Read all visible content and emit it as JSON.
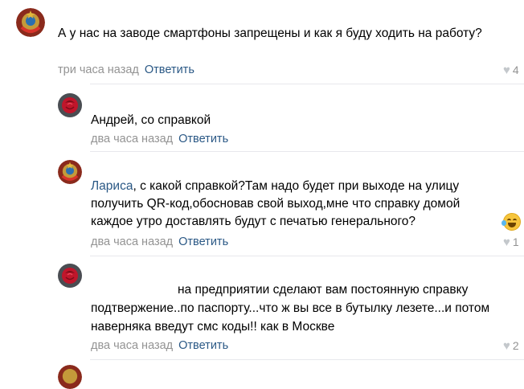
{
  "colors": {
    "link": "#2a5885",
    "meta": "#939393",
    "divider": "#e7e8ec",
    "avatar_red": "#c0162b"
  },
  "comments": [
    {
      "avatar_icon": "soviet-emblem-icon",
      "lines": [
        "А у нас на заводе смартфоны запрещены и как я буду ходить на работу?"
      ],
      "time": "три часа назад",
      "reply_label": "Ответить",
      "likes": "4"
    },
    {
      "avatar_icon": "red-rose-icon",
      "lines": [
        "Андрей, со справкой"
      ],
      "time": "два часа назад",
      "reply_label": "Ответить",
      "likes": ""
    },
    {
      "avatar_icon": "soviet-emblem-icon",
      "mention": "Лариса",
      "lines": [
        ", с какой справкой?Там надо будет при выходе на улицу",
        "получить QR-код,обосновав свой выход,мне что справку домой",
        "каждое утро доставлять будут с печатью генерального?"
      ],
      "emoji_icon": "rolling-laughing-emoji-icon",
      "time": "два часа назад",
      "reply_label": "Ответить",
      "likes": "1"
    },
    {
      "avatar_icon": "red-rose-icon",
      "lines": [
        "на предприятии сделают вам постоянную справку",
        "подтвержение..по паспорту...что ж вы все в бутылку лезете...и потом",
        "наверняка введут смс коды!! как в Москве"
      ],
      "time": "два часа назад",
      "reply_label": "Ответить",
      "likes": "2"
    }
  ]
}
